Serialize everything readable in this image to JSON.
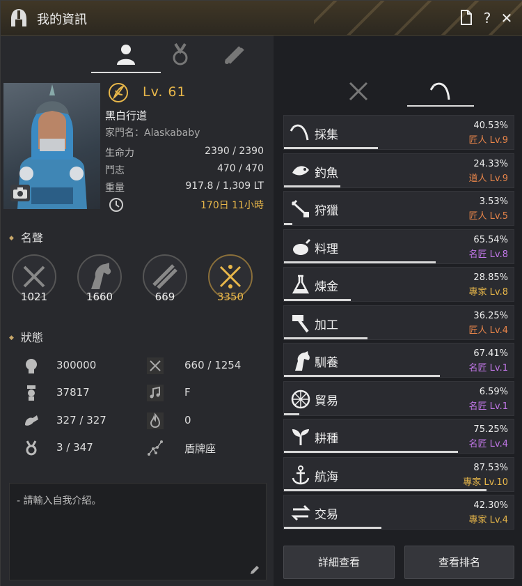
{
  "window": {
    "title": "我的資訊"
  },
  "profile": {
    "level": "Lv. 61",
    "name": "黑白行道",
    "family": "家門名：Alaskababy"
  },
  "stats": [
    {
      "label": "生命力",
      "value": "2390 / 2390"
    },
    {
      "label": "鬥志",
      "value": "470 / 470"
    },
    {
      "label": "重量",
      "value": "917.8 / 1,309 LT"
    }
  ],
  "playtime": "170日 11小時",
  "fame": {
    "title": "名聲",
    "items": [
      {
        "icon": "combat-fame-icon",
        "value": "1021"
      },
      {
        "icon": "life-fame-icon",
        "value": "1660"
      },
      {
        "icon": "knowledge-fame-icon",
        "value": "669"
      },
      {
        "icon": "total-fame-icon",
        "value": "3350"
      }
    ]
  },
  "status": {
    "title": "狀態",
    "items": [
      {
        "icon": "contribution-icon",
        "value": "300000"
      },
      {
        "icon": "skill-points-icon",
        "value": "660 / 1254"
      },
      {
        "icon": "energy-icon",
        "value": "37817"
      },
      {
        "icon": "music-icon",
        "value": "F"
      },
      {
        "icon": "stamina-icon",
        "value": "327 / 327"
      },
      {
        "icon": "fire-icon",
        "value": "0"
      },
      {
        "icon": "inventory-icon",
        "value": "3 / 347"
      },
      {
        "icon": "constellation-icon",
        "value": "盾牌座"
      }
    ]
  },
  "intro": {
    "placeholder": "- 請輸入自我介紹。"
  },
  "life_skills": [
    {
      "name": "採集",
      "pct": "40.53%",
      "rank": "匠人 Lv.9",
      "rank_color": "#e8854a",
      "progress": 0.4053
    },
    {
      "name": "釣魚",
      "pct": "24.33%",
      "rank": "道人 Lv.9",
      "rank_color": "#e8854a",
      "progress": 0.2433
    },
    {
      "name": "狩獵",
      "pct": "3.53%",
      "rank": "匠人 Lv.5",
      "rank_color": "#e8854a",
      "progress": 0.0353
    },
    {
      "name": "料理",
      "pct": "65.54%",
      "rank": "名匠 Lv.8",
      "rank_color": "#c277e8",
      "progress": 0.6554
    },
    {
      "name": "煉金",
      "pct": "28.85%",
      "rank": "專家 Lv.8",
      "rank_color": "#e8b74a",
      "progress": 0.2885
    },
    {
      "name": "加工",
      "pct": "36.25%",
      "rank": "匠人 Lv.4",
      "rank_color": "#e8854a",
      "progress": 0.3625
    },
    {
      "name": "馴養",
      "pct": "67.41%",
      "rank": "名匠 Lv.1",
      "rank_color": "#c277e8",
      "progress": 0.6741
    },
    {
      "name": "貿易",
      "pct": "6.59%",
      "rank": "名匠 Lv.1",
      "rank_color": "#c277e8",
      "progress": 0.0659
    },
    {
      "name": "耕種",
      "pct": "75.25%",
      "rank": "名匠 Lv.4",
      "rank_color": "#c277e8",
      "progress": 0.7525
    },
    {
      "name": "航海",
      "pct": "87.53%",
      "rank": "專家 Lv.10",
      "rank_color": "#e8b74a",
      "progress": 0.8753
    },
    {
      "name": "交易",
      "pct": "42.30%",
      "rank": "專家 Lv.4",
      "rank_color": "#e8b74a",
      "progress": 0.423
    }
  ],
  "buttons": {
    "detail": "詳細查看",
    "ranking": "查看排名"
  }
}
